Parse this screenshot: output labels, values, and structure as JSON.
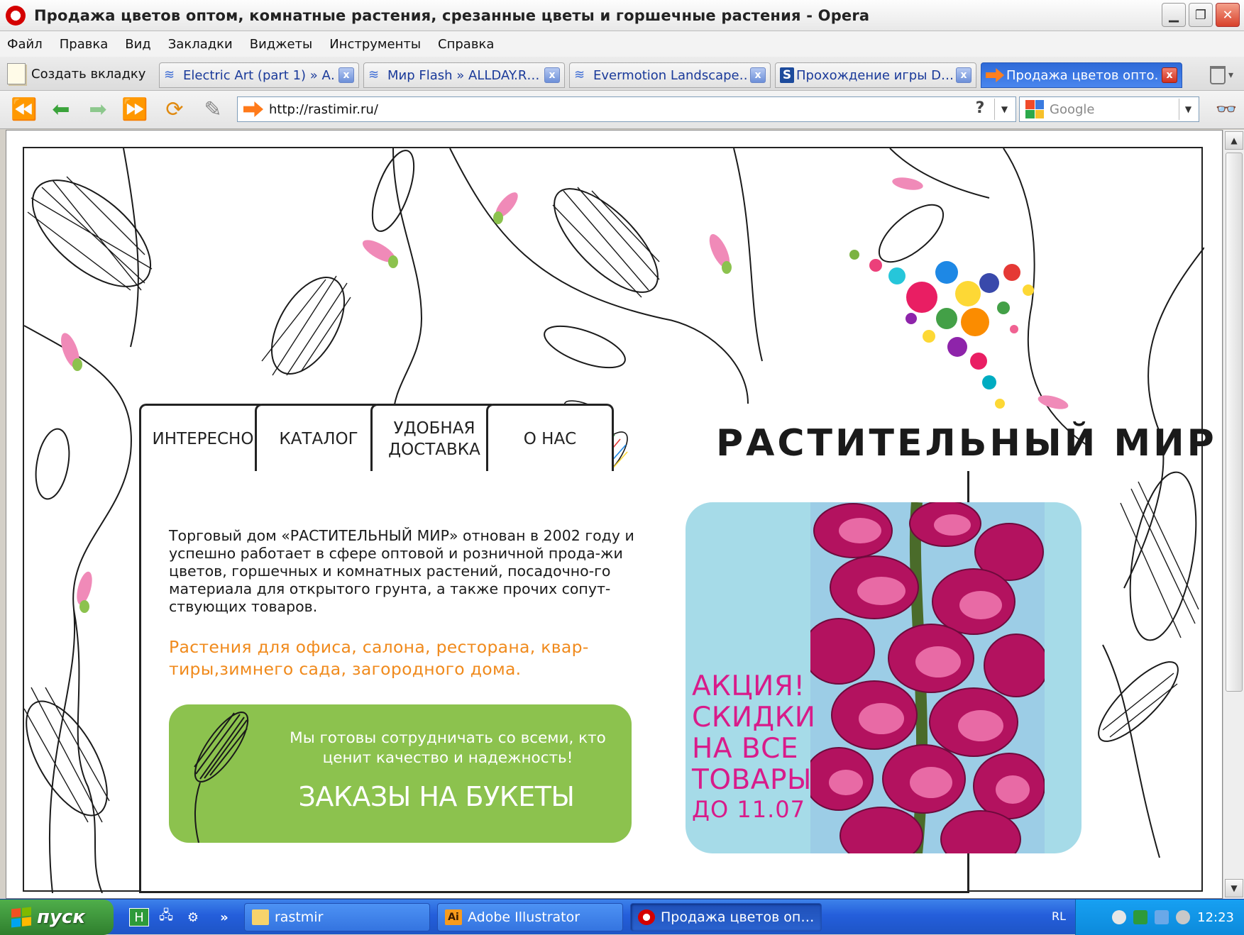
{
  "window": {
    "title": "Продажа цветов оптом, комнатные растения, срезанные цветы и горшечные растения - Opera",
    "controls": [
      "minimize",
      "restore",
      "close"
    ]
  },
  "menu": [
    "Файл",
    "Правка",
    "Вид",
    "Закладки",
    "Виджеты",
    "Инструменты",
    "Справка"
  ],
  "tabs": {
    "new_tab": "Создать вкладку",
    "items": [
      {
        "label": "Electric Art (part 1) » A…",
        "icon": "wave-icon"
      },
      {
        "label": "Мир Flash » ALLDAY.R…",
        "icon": "wave-icon"
      },
      {
        "label": "Evermotion Landscape…",
        "icon": "wave-icon"
      },
      {
        "label": "Прохождение игры D…",
        "icon": "s-icon",
        "icon_text": "S"
      },
      {
        "label": "Продажа цветов опто…",
        "icon": "arrow-icon",
        "active": true
      }
    ]
  },
  "address": {
    "url": "http://rastimir.ru/",
    "help": "?"
  },
  "search": {
    "placeholder": "Google"
  },
  "site": {
    "brand": "РАСТИТЕЛЬНЫЙ МИР",
    "nav": [
      {
        "label": "ИНТЕРЕСНО"
      },
      {
        "label": "КАТАЛОГ"
      },
      {
        "label": "УДОБНАЯ\nДОСТАВКА"
      },
      {
        "label": "О НАС"
      }
    ],
    "intro": "Торговый дом «РАСТИТЕЛЬНЫЙ МИР» отнован в 2002 году и успешно работает в сфере оптовой и розничной прода-жи цветов, горшечных и комнатных растений, посадочно-го материала для открытого грунта, а также прочих сопут-ствующих товаров.",
    "offer": "Растения для офиса, салона, ресторана, квар-тиры,зимнего сада, загородного дома.",
    "green_box": {
      "message": "Мы готовы сотрудничать со всеми, кто ценит качество и надежность!",
      "cta": "ЗАКАЗЫ НА БУКЕТЫ"
    },
    "promo": {
      "sale_lines": [
        "АКЦИЯ!",
        "СКИДКИ",
        "НА ВСЕ",
        "ТОВАРЫ"
      ],
      "date": "ДО 11.07"
    },
    "colors": {
      "offer": "#f08a1c",
      "green": "#8cc24e",
      "promo_bg": "#a6dbe8",
      "promo_text": "#d81b8a"
    }
  },
  "taskbar": {
    "start": "пуск",
    "quicklaunch_more": "»",
    "tasks": [
      {
        "label": "rastmir",
        "icon": "folder-icon"
      },
      {
        "label": "Adobe Illustrator",
        "icon": "illustrator-icon",
        "icon_text": "Ai"
      },
      {
        "label": "Продажа цветов оп…",
        "icon": "opera-icon",
        "active": true
      }
    ],
    "lang": "RL",
    "clock": "12:23"
  }
}
